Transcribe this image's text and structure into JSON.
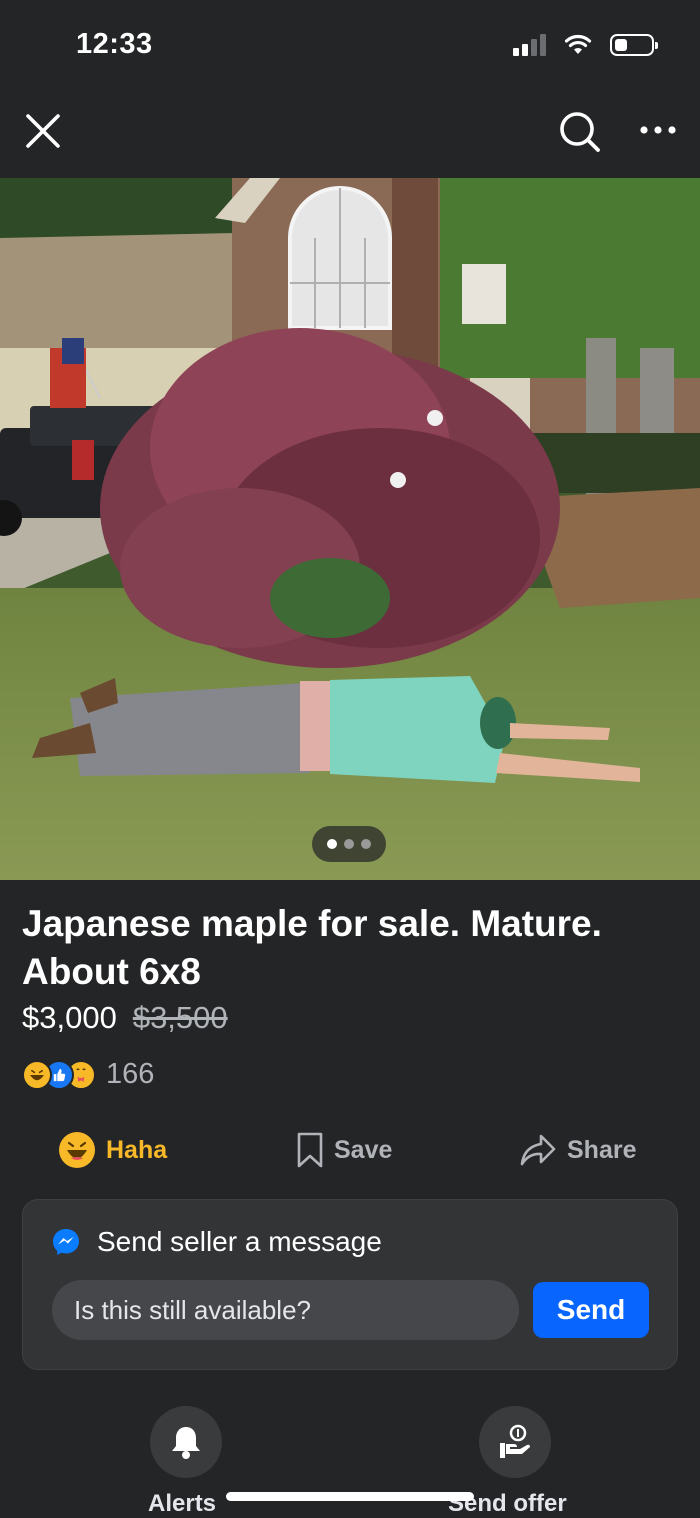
{
  "status_bar": {
    "time": "12:33",
    "signal_icon": "cellular-signal-icon",
    "wifi_icon": "wifi-icon",
    "battery_icon": "battery-icon",
    "battery_level": 0.35
  },
  "nav": {
    "close_icon": "close-icon",
    "search_icon": "search-icon",
    "more_icon": "more-options-icon"
  },
  "photo": {
    "pager_dots": 3,
    "active_dot": 0
  },
  "listing": {
    "title": "Japanese maple for sale. Mature. About 6x8",
    "price": "$3,000",
    "original_price": "$3,500"
  },
  "reactions": {
    "icons": [
      "haha-reaction-icon",
      "like-reaction-icon",
      "care-reaction-icon"
    ],
    "count": "166"
  },
  "actions": {
    "haha_label": "Haha",
    "save_label": "Save",
    "share_label": "Share"
  },
  "message": {
    "heading": "Send seller a message",
    "input_value": "Is this still available?",
    "send_label": "Send"
  },
  "bottom": {
    "alerts_label": "Alerts",
    "offer_label": "Send offer"
  },
  "colors": {
    "background": "#242526",
    "accent": "#0866ff",
    "haha": "#f7b928"
  }
}
